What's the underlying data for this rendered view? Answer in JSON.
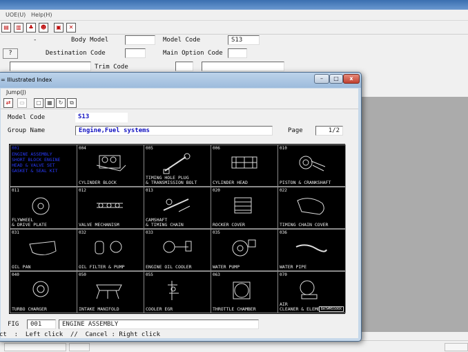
{
  "app": {
    "menu": [
      "UOE(U)",
      "Help(H)"
    ],
    "form": {
      "dash": "-",
      "body_model_label": "Body Model",
      "body_model_value": "",
      "model_code_label": "Model Code",
      "model_code_value": "S13",
      "help_button": "?",
      "destination_code_label": "Destination Code",
      "destination_code_value": "",
      "main_option_code_label": "Main Option Code",
      "main_option_code_value": "",
      "trim_code_label": "Trim Code",
      "trim_code_value": ""
    }
  },
  "window": {
    "title": "= Illustrated Index",
    "menu": "Jump(J)",
    "model_code_label": "Model Code",
    "model_code_value": "S13",
    "group_name_label": "Group Name",
    "group_name_value": "Engine,Fuel systems",
    "page_label": "Page",
    "page_value": "1/2",
    "fig_label": "FIG",
    "fig_value": "001",
    "fig_name": "ENGINE ASSEMBLY",
    "hint": "ct  :  Left click  //  Cancel : Right click",
    "cells": [
      {
        "code": "001",
        "name": "ENGINE ASSEMBLY\nSHORT BLOCK ENGINE\nHEAD & VALVE SET\nGASKET & SEAL KIT",
        "selected": true
      },
      {
        "code": "004",
        "name": "CYLINDER BLOCK"
      },
      {
        "code": "005",
        "name": "TIMING HOLE PLUG\n& TRANSMISSION BOLT"
      },
      {
        "code": "006",
        "name": "CYLINDER HEAD"
      },
      {
        "code": "010",
        "name": "PISTON & CRANKSHAFT"
      },
      {
        "code": "011",
        "name": "FLYWHEEL\n& DRIVE PLATE"
      },
      {
        "code": "012",
        "name": "VALVE MECHANISM"
      },
      {
        "code": "013",
        "name": "CAMSHAFT\n& TIMING CHAIN"
      },
      {
        "code": "020",
        "name": "ROCKER COVER"
      },
      {
        "code": "022",
        "name": "TIMING CHAIN COVER"
      },
      {
        "code": "031",
        "name": "OIL PAN"
      },
      {
        "code": "032",
        "name": "OIL FILTER & PUMP"
      },
      {
        "code": "033",
        "name": "ENGINE OIL COOLER"
      },
      {
        "code": "035",
        "name": "WATER PUMP"
      },
      {
        "code": "036",
        "name": "WATER PIPE"
      },
      {
        "code": "040",
        "name": "TURBO CHARGER"
      },
      {
        "code": "050",
        "name": "INTAKE MANIFOLD"
      },
      {
        "code": "055",
        "name": "COOLER EGR"
      },
      {
        "code": "063",
        "name": "THROTTLE CHAMBER"
      },
      {
        "code": "070",
        "name": "AIR\nCLEANER & ELEMENT"
      }
    ],
    "badge": "BAT#M5500X"
  }
}
